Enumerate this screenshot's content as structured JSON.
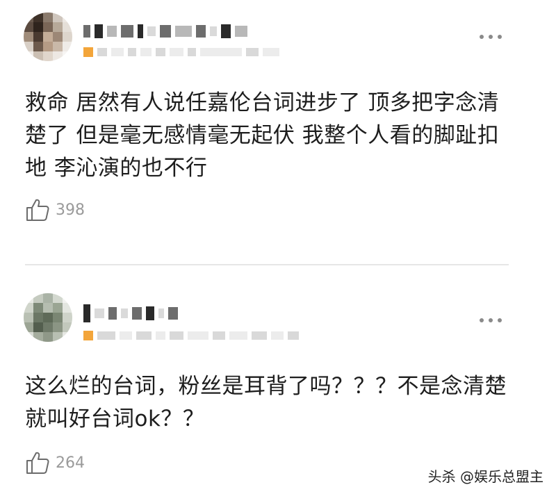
{
  "posts": [
    {
      "text": "救命 居然有人说任嘉伦台词进步了 顶多把字念清楚了 但是毫无感情毫无起伏 我整个人看的脚趾扣地 李沁演的也不行",
      "likes": "398",
      "like_icon": "thumbs-up-icon",
      "more_icon": "more-options-icon"
    },
    {
      "text": "这么烂的台词，粉丝是耳背了吗？？？不是念清楚就叫好台词ok？？",
      "likes": "264",
      "like_icon": "thumbs-up-icon",
      "more_icon": "more-options-icon"
    }
  ],
  "watermark": "头杀 @娱乐总盟主",
  "colors": {
    "text": "#1d1d1d",
    "like_count": "#9a9a9a",
    "divider": "#e6e6e6",
    "badge": "#f3a53a"
  }
}
